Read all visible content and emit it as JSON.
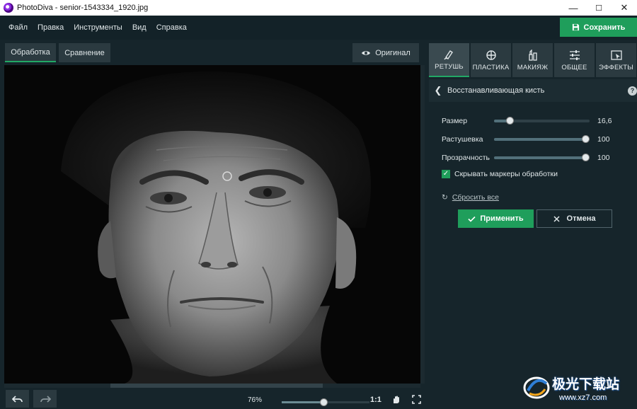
{
  "window": {
    "title": "PhotoDiva - senior-1543334_1920.jpg",
    "minimize": "—",
    "maximize": "☐",
    "close": "✕"
  },
  "menu": [
    "Файл",
    "Правка",
    "Инструменты",
    "Вид",
    "Справка"
  ],
  "save_button": "Сохранить",
  "view_tabs": [
    {
      "label": "Обработка",
      "active": true
    },
    {
      "label": "Сравнение",
      "active": false
    }
  ],
  "original_button": "Оригинал",
  "zoom": {
    "percent": "76%",
    "level": 0.48,
    "one_to_one": "1:1"
  },
  "panel_tabs": [
    {
      "label": "РЕТУШЬ",
      "icon": "retouch-brush-icon",
      "active": true
    },
    {
      "label": "ПЛАСТИКА",
      "icon": "plastic-crosshair-icon",
      "active": false
    },
    {
      "label": "МАКИЯЖ",
      "icon": "makeup-icon",
      "active": false
    },
    {
      "label": "ОБЩЕЕ",
      "icon": "sliders-icon",
      "active": false
    },
    {
      "label": "ЭФФЕКТЫ",
      "icon": "effects-icon",
      "active": false
    }
  ],
  "tool": {
    "title": "Восстанавливающая кисть",
    "help": "?",
    "sliders": [
      {
        "label": "Размер",
        "value": "16,6",
        "level": 0.14
      },
      {
        "label": "Растушевка",
        "value": "100",
        "level": 1.0
      },
      {
        "label": "Прозрачность",
        "value": "100",
        "level": 1.0
      }
    ],
    "hide_markers": {
      "label": "Скрывать маркеры обработки",
      "checked": true
    },
    "reset_label": "Сбросить все",
    "apply_label": "Применить",
    "cancel_label": "Отмена"
  },
  "watermark": {
    "text": "极光下载站",
    "url": "www.xz7.com"
  },
  "colors": {
    "accent": "#1f9e5b",
    "background": "#16252b",
    "tab": "#2b3a40"
  }
}
